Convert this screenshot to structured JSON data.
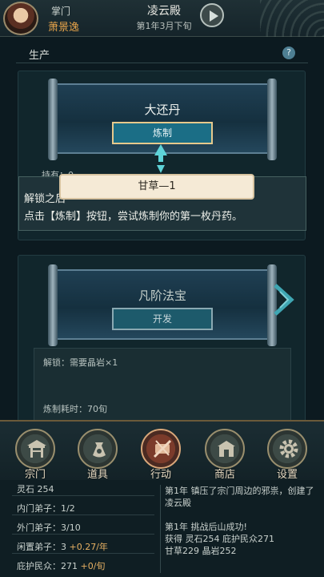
{
  "header": {
    "role": "掌门",
    "player_name": "萧景逸",
    "title": "凌云殿",
    "date": "第1年3月下旬"
  },
  "production": {
    "section_label": "生产",
    "help_label": "?",
    "item1": {
      "name": "大还丹",
      "button": "炼制",
      "hidden_label": "持有：0"
    },
    "item2": {
      "name": "凡阶法宝",
      "button": "开发",
      "unlock": "解锁：需要晶岩×1",
      "craft_time": "炼制耗时：70旬"
    }
  },
  "tooltip": {
    "banner": "甘草—1",
    "line1": "解锁之后",
    "line2": "点击【炼制】按钮，尝试炼制你的第一枚丹药。"
  },
  "nav": [
    {
      "label": "宗门",
      "icon": "sect-gate-icon"
    },
    {
      "label": "道具",
      "icon": "item-bag-icon"
    },
    {
      "label": "行动",
      "icon": "action-scroll-icon"
    },
    {
      "label": "商店",
      "icon": "shop-icon"
    },
    {
      "label": "设置",
      "icon": "gear-icon"
    }
  ],
  "stats": {
    "spirit_stone": "灵石 254",
    "inner": "内门弟子：1/2",
    "outer": "外门弟子：3/10",
    "idle_label": "闲置弟子：3",
    "idle_delta": "+0.27/年",
    "protected_label": "庇护民众：271",
    "protected_delta": "+0/旬"
  },
  "log": [
    "第1年 镇压了宗门周边的邪祟，创建了凌云殿",
    "第1年 挑战后山成功!",
    "获得 灵石254 庇护民众271",
    "甘草229 晶岩252"
  ],
  "colors": {
    "accent_gold": "#e6a34a",
    "button_teal": "#1b6e86",
    "tooltip_bg": "#f5ead6"
  }
}
